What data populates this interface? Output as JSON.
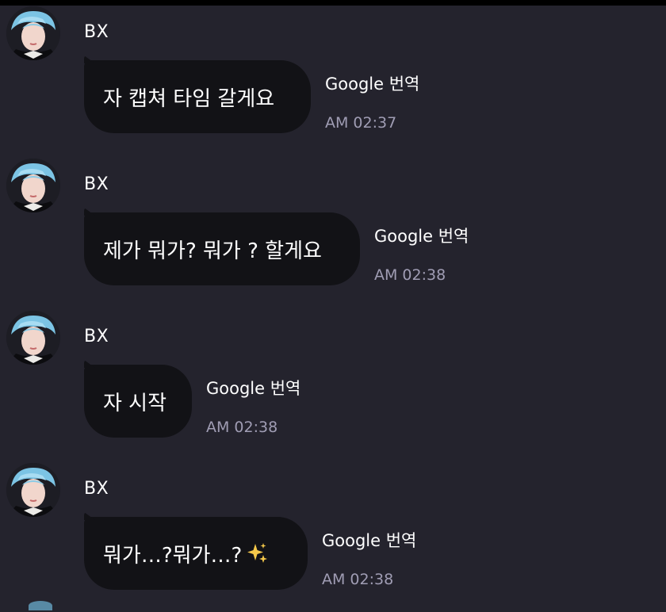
{
  "messages": [
    {
      "sender": "BX",
      "text": "자 캡쳐 타임 갈게요",
      "translate_label": "Google 번역",
      "time": "AM 02:37",
      "has_sparkle": false
    },
    {
      "sender": "BX",
      "text": "제가 뭐가? 뭐가 ? 할게요",
      "translate_label": "Google 번역",
      "time": "AM 02:38",
      "has_sparkle": false
    },
    {
      "sender": "BX",
      "text": "자 시작",
      "translate_label": "Google 번역",
      "time": "AM 02:38",
      "has_sparkle": false
    },
    {
      "sender": "BX",
      "text": "뭐가…?뭐가…?",
      "translate_label": "Google 번역",
      "time": "AM 02:38",
      "has_sparkle": true,
      "sparkle_icon": "sparkles-icon"
    }
  ],
  "colors": {
    "background": "#24232d",
    "bubble": "#121216",
    "timestamp": "#a09db4",
    "sparkle": "#f5c84a"
  }
}
